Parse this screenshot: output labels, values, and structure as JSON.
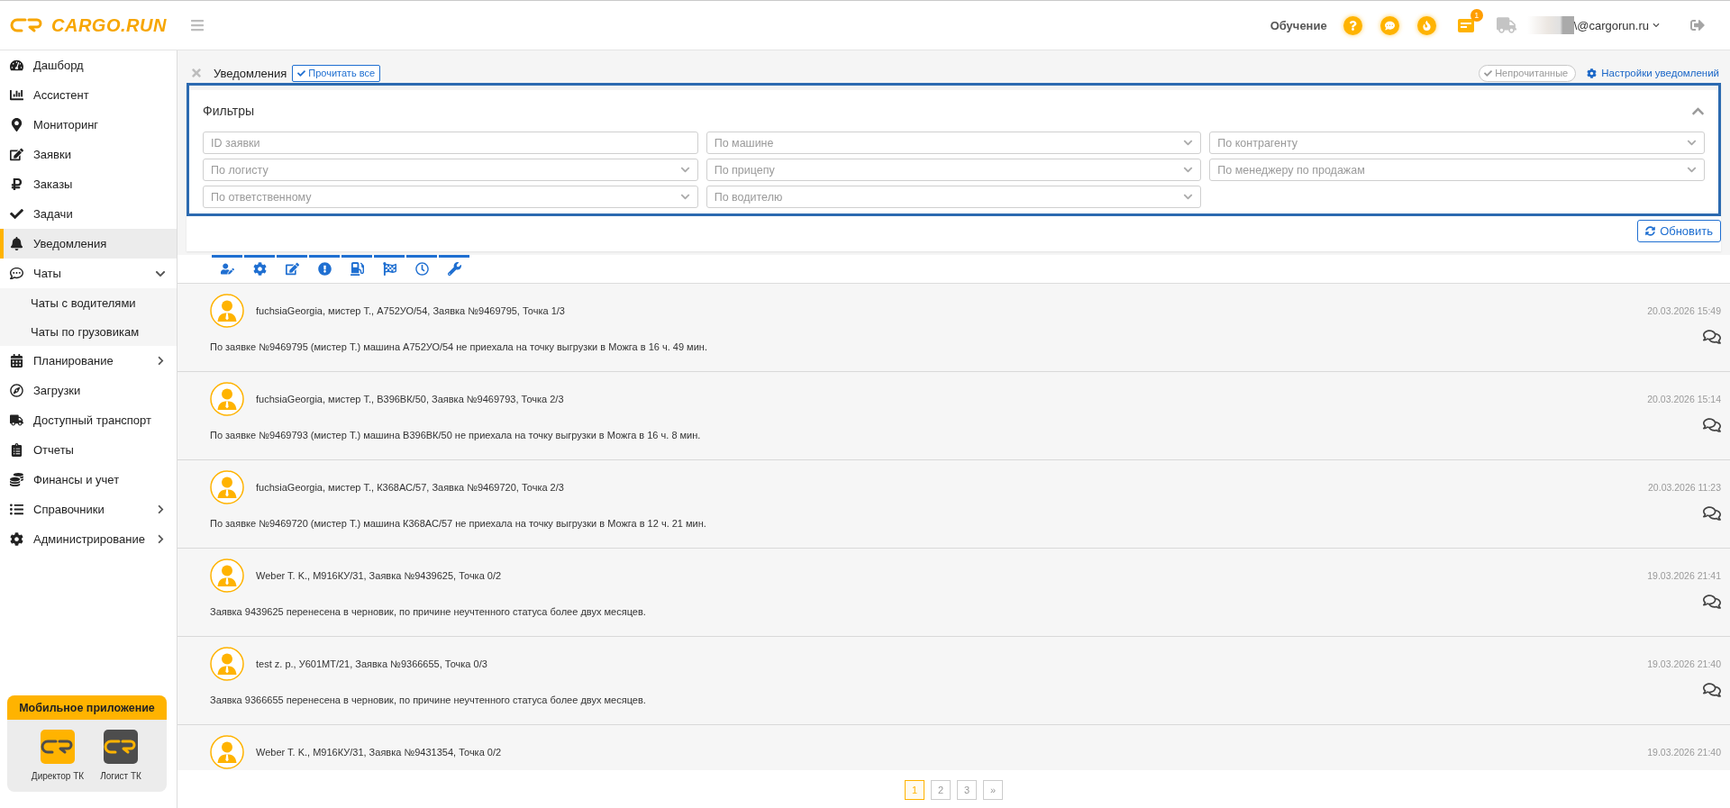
{
  "header": {
    "brand": "CARGO.RUN",
    "learning_link": "Обучение",
    "notification_count": "1",
    "user_email": "\\@cargorun.ru"
  },
  "sidebar": {
    "items": [
      {
        "label": "Дашборд",
        "selected": false
      },
      {
        "label": "Ассистент",
        "selected": false
      },
      {
        "label": "Мониторинг",
        "selected": false
      },
      {
        "label": "Заявки",
        "selected": false
      },
      {
        "label": "Заказы",
        "selected": false
      },
      {
        "label": "Задачи",
        "selected": false
      },
      {
        "label": "Уведомления",
        "selected": true
      },
      {
        "label": "Чаты",
        "selected": false,
        "expanded": true,
        "children": [
          {
            "label": "Чаты с водителями",
            "selected": false
          },
          {
            "label": "Чаты по грузовикам",
            "selected": false
          }
        ]
      },
      {
        "label": "Планирование",
        "selected": false,
        "expanded": false
      },
      {
        "label": "Загрузки",
        "selected": false
      },
      {
        "label": "Доступный транспорт",
        "selected": false
      },
      {
        "label": "Отчеты",
        "selected": false
      },
      {
        "label": "Финансы и учет",
        "selected": false
      },
      {
        "label": "Справочники",
        "selected": false,
        "expanded": false
      },
      {
        "label": "Администрирование",
        "selected": false,
        "expanded": false
      }
    ],
    "mobile_apps": {
      "title": "Мобильное приложение",
      "apps": [
        {
          "label": "Директор ТК",
          "color": "#ffb300"
        },
        {
          "label": "Логист ТК",
          "color": "#4d4d4d"
        }
      ]
    }
  },
  "notifications_page": {
    "title": "Уведомления",
    "mark_all_read": "Прочитать все",
    "unread_filter": {
      "label": "Непрочитанные",
      "on": false
    },
    "settings_link": "Настройки уведомлений"
  },
  "filters": {
    "title": "Фильтры",
    "expanded": true,
    "fields": [
      {
        "kind": "text",
        "placeholder": "ID заявки"
      },
      {
        "kind": "select",
        "placeholder": "По машине"
      },
      {
        "kind": "select",
        "placeholder": "По контрагенту"
      },
      {
        "kind": "select",
        "placeholder": "По логисту"
      },
      {
        "kind": "select",
        "placeholder": "По прицепу"
      },
      {
        "kind": "select",
        "placeholder": "По менеджеру по продажам"
      },
      {
        "kind": "select",
        "placeholder": "По ответственному"
      },
      {
        "kind": "select",
        "placeholder": "По водителю"
      }
    ],
    "refresh_button": "Обновить"
  },
  "category_tabs": [
    {
      "on": true
    },
    {
      "on": true
    },
    {
      "on": true
    },
    {
      "on": true
    },
    {
      "on": true
    },
    {
      "on": true
    },
    {
      "on": true
    },
    {
      "on": true
    }
  ],
  "notifications": [
    {
      "title": "fuchsiaGeorgia, мистер Т., А752УО/54, Заявка №9469795, Точка 1/3",
      "time": "20.03.2026 15:49",
      "message": "По заявке №9469795 (мистер Т.) машина А752УО/54 не приехала на точку выгрузки в Можга в 16 ч. 49 мин."
    },
    {
      "title": "fuchsiaGeorgia, мистер Т., В396ВК/50, Заявка №9469793, Точка 2/3",
      "time": "20.03.2026 15:14",
      "message": "По заявке №9469793 (мистер Т.) машина В396ВК/50 не приехала на точку выгрузки в Можга в 16 ч. 8 мин."
    },
    {
      "title": "fuchsiaGeorgia, мистер Т., К368АС/57, Заявка №9469720, Точка 2/3",
      "time": "20.03.2026 11:23",
      "message": "По заявке №9469720 (мистер Т.) машина К368АС/57 не приехала на точку выгрузки в Можга в 12 ч. 21 мин."
    },
    {
      "title": "Weber T. K., М916КУ/31, Заявка №9439625, Точка 0/2",
      "time": "19.03.2026 21:41",
      "message": "Заявка 9439625 перенесена в черновик, по причине неучтенного статуса более двух месяцев."
    },
    {
      "title": "test z. p., У601МТ/21, Заявка №9366655, Точка 0/3",
      "time": "19.03.2026 21:40",
      "message": "Заявка 9366655 перенесена в черновик, по причине неучтенного статуса более двух месяцев."
    },
    {
      "title": "Weber T. K., М916КУ/31, Заявка №9431354, Точка 0/2",
      "time": "19.03.2026 21:40"
    }
  ],
  "pagination": [
    {
      "label": "1",
      "selected": true
    },
    {
      "label": "2",
      "selected": false
    },
    {
      "label": "3",
      "selected": false
    },
    {
      "label": "»",
      "selected": false
    }
  ]
}
